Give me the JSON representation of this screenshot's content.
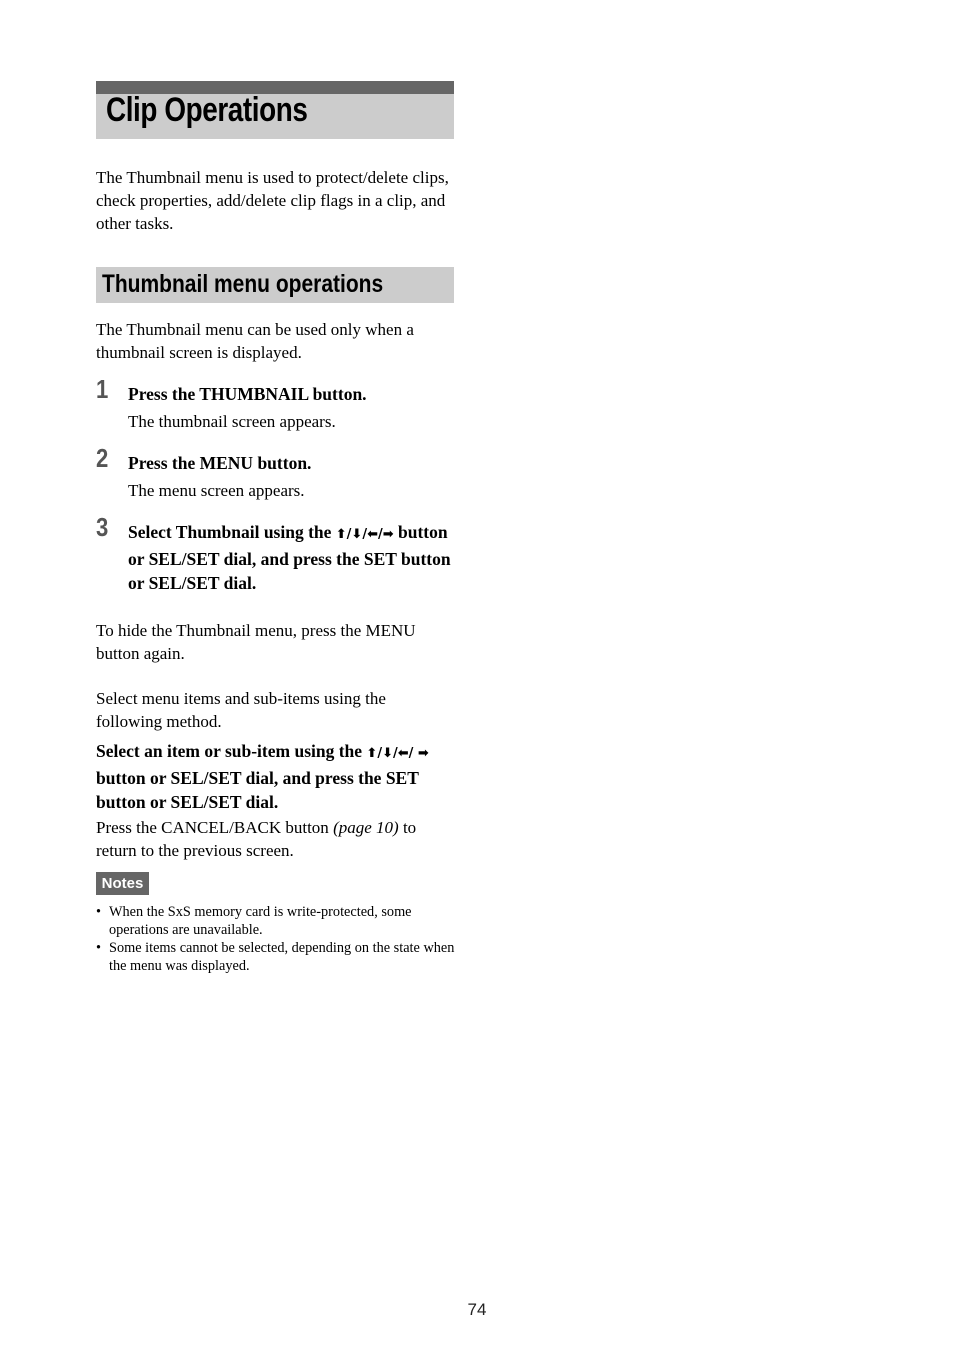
{
  "chapter": {
    "title": "Clip Operations"
  },
  "intro": "The Thumbnail menu is used to protect/delete clips, check properties, add/delete clip flags in a clip, and other tasks.",
  "section": {
    "title": "Thumbnail menu operations",
    "lead": "The Thumbnail menu can be used only when a thumbnail screen is displayed."
  },
  "steps": [
    {
      "number": "1",
      "title": "Press the THUMBNAIL button.",
      "desc": "The thumbnail screen appears."
    },
    {
      "number": "2",
      "title": "Press the MENU button.",
      "desc": "The menu screen appears."
    },
    {
      "number": "3",
      "title_pre": "Select Thumbnail using the ",
      "arrows": "⬆/⬇/⬅/➡",
      "title_post": " button or SEL/SET dial, and press the SET button or SEL/SET dial."
    }
  ],
  "hide_text": "To hide the Thumbnail menu, press the MENU button again.",
  "select_text": "Select menu items and sub-items using the following method.",
  "method": {
    "pre": "Select an item or sub-item using the ",
    "arrows": "⬆/⬇/⬅/ ➡",
    "post": " button or SEL/SET dial, and press the SET button or SEL/SET dial."
  },
  "cancel": {
    "pre": "Press the CANCEL/BACK button ",
    "link": "(page 10)",
    "post": " to return to the previous screen."
  },
  "notes": {
    "label": "Notes",
    "items": [
      "When the SxS memory card is write-protected, some operations are unavailable.",
      "Some items cannot be selected, depending on the state when the menu was displayed."
    ]
  },
  "page_number": "74"
}
